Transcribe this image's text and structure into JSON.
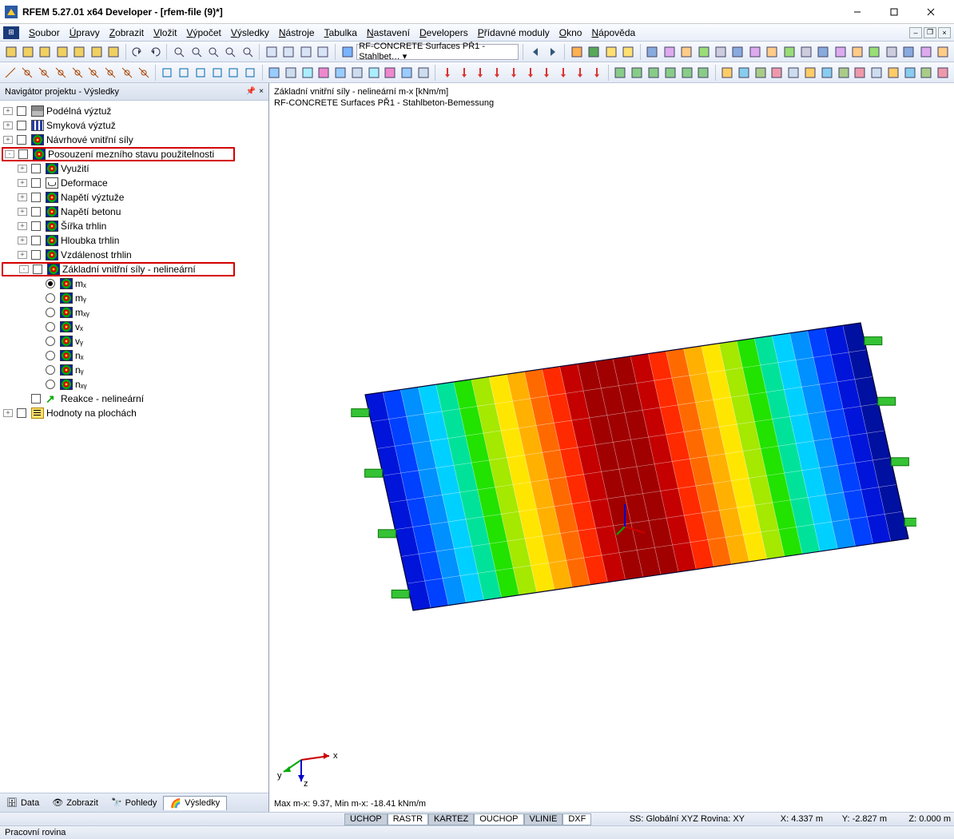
{
  "app": {
    "title": "RFEM 5.27.01 x64 Developer - [rfem-file (9)*]"
  },
  "menu": {
    "items": [
      "Soubor",
      "Úpravy",
      "Zobrazit",
      "Vložit",
      "Výpočet",
      "Výsledky",
      "Nástroje",
      "Tabulka",
      "Nastavení",
      "Developers",
      "Přídavné moduly",
      "Okno",
      "Nápověda"
    ]
  },
  "toolbar": {
    "module_select": "RF-CONCRETE Surfaces PŘ1 - Stahlbet…"
  },
  "sidebar": {
    "title": "Navigátor projektu - Výsledky",
    "items": [
      {
        "label": "Podélná výztuž",
        "icon": "longi"
      },
      {
        "label": "Smyková výztuž",
        "icon": "shear"
      },
      {
        "label": "Návrhové vnitřní síly",
        "icon": "rb"
      },
      {
        "label": "Posouzení mezního stavu použitelnosti",
        "icon": "rb",
        "hl": true,
        "exp": "-",
        "children": [
          {
            "label": "Využití",
            "icon": "rb"
          },
          {
            "label": "Deformace",
            "icon": "def"
          },
          {
            "label": "Napětí výztuže",
            "icon": "rb"
          },
          {
            "label": "Napětí betonu",
            "icon": "rb"
          },
          {
            "label": "Šířka trhlin",
            "icon": "rb"
          },
          {
            "label": "Hloubka trhlin",
            "icon": "rb"
          },
          {
            "label": "Vzdálenost trhlin",
            "icon": "rb"
          },
          {
            "label": "Základní vnitřní síly - nelineární",
            "icon": "rb",
            "hl": true,
            "exp": "-",
            "children": [
              {
                "label": "mₓ",
                "sel": true
              },
              {
                "label": "mᵧ"
              },
              {
                "label": "mₓᵧ"
              },
              {
                "label": "vₓ"
              },
              {
                "label": "vᵧ"
              },
              {
                "label": "nₓ"
              },
              {
                "label": "nᵧ"
              },
              {
                "label": "nₓᵧ"
              }
            ]
          },
          {
            "label": "Reakce - nelineární",
            "icon": "react",
            "noexpand": true
          }
        ]
      },
      {
        "label": "Hodnoty na plochách",
        "icon": "vals"
      }
    ],
    "tabs": [
      "Data",
      "Zobrazit",
      "Pohledy",
      "Výsledky"
    ],
    "activeTab": 3
  },
  "viewport": {
    "line1": "Základní vnitřní síly - nelineární m-x [kNm/m]",
    "line2": "RF-CONCRETE Surfaces PŘ1 - Stahlbeton-Bemessung",
    "minmax": "Max m-x: 9.37, Min m-x: -18.41 kNm/m",
    "axes": {
      "x": "x",
      "y": "y",
      "z": "z"
    }
  },
  "status": {
    "row1": {
      "toggles": [
        "UCHOP",
        "RASTR",
        "KARTEZ",
        "OUCHOP",
        "VLINIE",
        "DXF"
      ],
      "active": [
        false,
        true,
        false,
        true,
        false,
        true
      ],
      "cs": "SS: Globální XYZ  Rovina: XY",
      "x": "X:   4.337 m",
      "y": "Y:  -2.827 m",
      "z": "Z:  0.000 m"
    },
    "row2": "Pracovní rovina"
  }
}
